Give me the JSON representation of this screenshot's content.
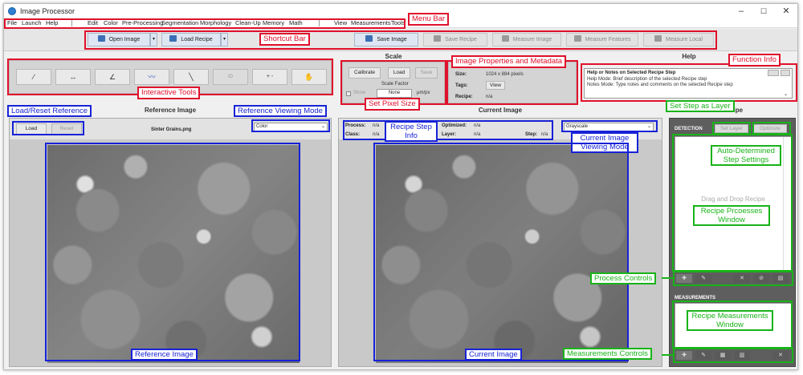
{
  "window": {
    "title": "Image Processor",
    "min": "–",
    "max": "☐",
    "close": "✕"
  },
  "menu": [
    "File",
    "Launch",
    "Help",
    "Edit",
    "Color",
    "Pre-Processing",
    "Segmentation",
    "Morphology",
    "Clean-Up",
    "Memory",
    "Math",
    "View",
    "Measurements",
    "Tools"
  ],
  "shortcut": {
    "open_image": "Open Image",
    "load_recipe": "Load Recipe",
    "save_image": "Save Image",
    "save_recipe": "Save Recipe",
    "measure_image": "Measure Image",
    "measure_features": "Measure Features",
    "measure_local": "Measure Local"
  },
  "tools": [
    "pipette-icon",
    "ruler-icon",
    "angle-icon",
    "profile-icon",
    "line-icon",
    "id-icon",
    "zoom-icon",
    "pan-icon"
  ],
  "tool_glyphs": {
    "id": "ID",
    "zoom": "+ -",
    "pan": "✋"
  },
  "scale": {
    "title": "Scale",
    "calibrate": "Calibrate",
    "load": "Load",
    "save": "Save",
    "scale_factor_label": "Scale Factor",
    "show_label": "Show",
    "value": "None",
    "unit": "µm/px"
  },
  "props": {
    "size_label": "Size:",
    "size_value": "1024 x 884 pixels",
    "tags_label": "Tags:",
    "tags_button": "View",
    "recipe_label": "Recipe:",
    "recipe_value": "n/a"
  },
  "help": {
    "title": "Help",
    "header": "Help or Notes on Selected Recipe Step",
    "line1": "Help Mode:   Brief description of the selected Recipe step",
    "line2": "Notes Mode:  Type notes and comments on the selected Recipe step"
  },
  "reference": {
    "title": "Reference Image",
    "load": "Load",
    "reset": "Reset",
    "filename": "Sinter Grains.png",
    "mode": "Color"
  },
  "current": {
    "title": "Current Image",
    "mode": "Grayscale",
    "process_label": "Process:",
    "process_value": "n/a",
    "class_label": "Class:",
    "class_value": "n/a",
    "optimized_label": "Optimized:",
    "optimized_value": "n/a",
    "layer_label": "Layer:",
    "layer_value": "n/a",
    "step_label": "Step:",
    "step_value": "n/a"
  },
  "recipe": {
    "title": "Recipe",
    "detection": "DETECTION",
    "set_layer": "Set Layer",
    "optimize": "Optimize",
    "placeholder": "Drag and Drop Recipe",
    "measurements": "MEASUREMENTS"
  },
  "callouts": {
    "menu_bar": "Menu Bar",
    "shortcut_bar": "Shortcut Bar",
    "interactive_tools": "Interactive Tools",
    "image_props": "Image Properties and Metadata",
    "set_pixel_size": "Set Pixel Size",
    "function_info": "Function Info",
    "load_reset_ref": "Load/Reset Reference",
    "ref_view_mode": "Reference Viewing Mode",
    "reference_image": "Reference Image",
    "recipe_step_info": "Recipe Step Info",
    "current_view_mode": "Current Image Viewing Mode",
    "current_image": "Current Image",
    "set_step_layer": "Set Step as Layer",
    "auto_settings": "Auto-Determined Step Settings",
    "recipe_processes": "Recipe Prcoesses Window",
    "process_controls": "Process Controls",
    "recipe_measurements": "Recipe Measurements Window",
    "measurements_controls": "Measurements Controls"
  },
  "colors": {
    "red": "#e0102b",
    "blue": "#1722d6",
    "green": "#18b318"
  }
}
